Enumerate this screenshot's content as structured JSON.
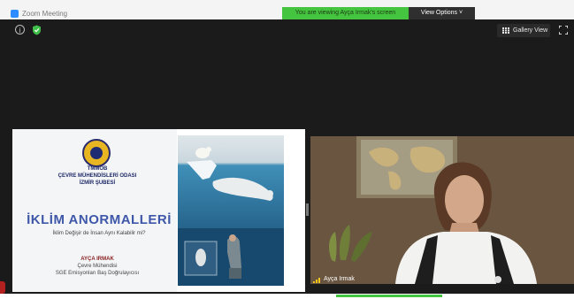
{
  "window": {
    "title": "Zoom Meeting"
  },
  "share_banner": {
    "text": "You are viewing Ayça Irmak's screen"
  },
  "view_options": {
    "label": "View Options ˅"
  },
  "toolbar": {
    "gallery_view_label": "Gallery View",
    "info_icon": "i"
  },
  "slide": {
    "org_line1": "TMMOB",
    "org_line2": "ÇEVRE MÜHENDİSLERİ ODASI",
    "org_line3": "İZMİR ŞUBESİ",
    "title": "İKLİM ANORMALLERİ",
    "subtitle": "İklim Değişir de İnsan Aynı Kalabilir mi?",
    "author": "AYÇA IRMAK",
    "role1": "Çevre Mühendisi",
    "role2": "SGE Emisyonları Baş Doğrulayıcısı"
  },
  "participant": {
    "name": "Ayça Irmak"
  },
  "colors": {
    "banner_green": "#45c43f",
    "meeting_bg": "#1b1b1b",
    "zoom_blue": "#2d8cff",
    "slide_title_blue": "#3f57a8"
  }
}
